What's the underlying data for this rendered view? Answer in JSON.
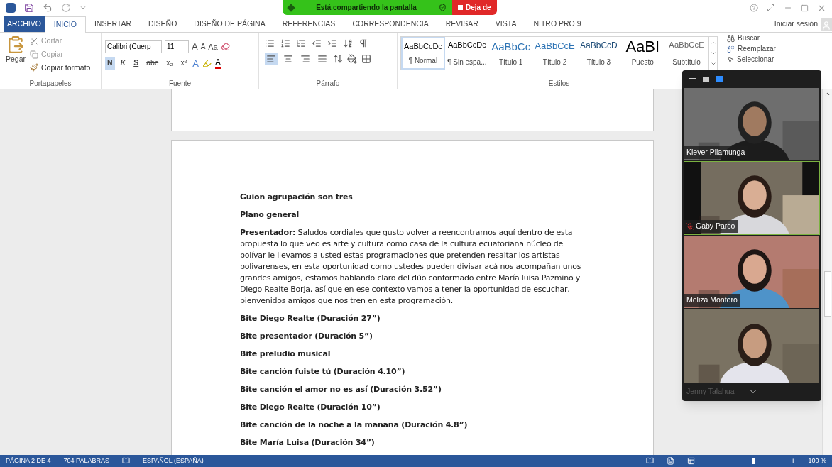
{
  "share_banner": {
    "message": "Está compartiendo la pantalla",
    "stop_label": "Deja de"
  },
  "menu_tabs": [
    {
      "label": "ARCHIVO",
      "kind": "file",
      "selected": false
    },
    {
      "label": "INICIO",
      "kind": "tab",
      "selected": true
    },
    {
      "label": "INSERTAR",
      "kind": "tab",
      "selected": false
    },
    {
      "label": "DISEÑO",
      "kind": "tab",
      "selected": false
    },
    {
      "label": "DISEÑO DE PÁGINA",
      "kind": "tab",
      "selected": false
    },
    {
      "label": "REFERENCIAS",
      "kind": "tab",
      "selected": false
    },
    {
      "label": "CORRESPONDENCIA",
      "kind": "tab",
      "selected": false
    },
    {
      "label": "REVISAR",
      "kind": "tab",
      "selected": false
    },
    {
      "label": "VISTA",
      "kind": "tab",
      "selected": false
    },
    {
      "label": "NITRO PRO 9",
      "kind": "tab",
      "selected": false
    }
  ],
  "sign_in": "Iniciar sesión",
  "clipboard": {
    "paste": "Pegar",
    "cut": "Cortar",
    "copy": "Copiar",
    "format_painter": "Copiar formato",
    "group": "Portapapeles"
  },
  "font": {
    "name": "Calibri (Cuerp",
    "size": "11",
    "grow": "A",
    "shrink": "A",
    "case": "Aa",
    "group": "Fuente",
    "styles": [
      {
        "label": "N",
        "kind": "bold",
        "selected": true
      },
      {
        "label": "K",
        "kind": "italic",
        "selected": false
      },
      {
        "label": "S",
        "kind": "underline",
        "selected": false
      },
      {
        "label": "abc",
        "kind": "strike",
        "selected": false
      },
      {
        "label": "x₂",
        "kind": "plain",
        "selected": false
      },
      {
        "label": "x²",
        "kind": "plain",
        "selected": false
      }
    ],
    "effects": "A",
    "color_letter": "A"
  },
  "paragraph": {
    "group": "Párrafo",
    "alignments": [
      {
        "kind": "left",
        "selected": true
      },
      {
        "kind": "center",
        "selected": false
      },
      {
        "kind": "right",
        "selected": false
      },
      {
        "kind": "justify",
        "selected": false
      }
    ]
  },
  "styles": {
    "group": "Estilos",
    "items": [
      {
        "sample": "AaBbCcDc",
        "name": "¶ Normal",
        "kind": "body",
        "selected": true
      },
      {
        "sample": "AaBbCcDc",
        "name": "¶ Sin espa...",
        "kind": "body",
        "selected": false
      },
      {
        "sample": "AaBbCc",
        "name": "Título 1",
        "kind": "h1",
        "selected": false
      },
      {
        "sample": "AaBbCcE",
        "name": "Título 2",
        "kind": "h2",
        "selected": false
      },
      {
        "sample": "AaBbCcD",
        "name": "Título 3",
        "kind": "h3",
        "selected": false
      },
      {
        "sample": "AaBI",
        "name": "Puesto",
        "kind": "title",
        "selected": false
      },
      {
        "sample": "AaBbCcE",
        "name": "Subtítulo",
        "kind": "subtitle",
        "selected": false
      }
    ]
  },
  "editing": {
    "find": "Buscar",
    "replace": "Reemplazar",
    "select": "Seleccionar"
  },
  "document": [
    {
      "kind": "heading",
      "text": "Guion agrupación son tres"
    },
    {
      "kind": "heading",
      "text": "Plano general"
    },
    {
      "kind": "paragraph",
      "text": "**Presentador:** Saludos cordiales que gusto volver a reencontrarnos aquí dentro de esta propuesta lo que veo es arte y cultura como casa de la cultura ecuatoriana núcleo de bolívar le llevamos a usted estas programaciones que pretenden resaltar los artistas bolivarenses, en esta oportunidad como ustedes pueden divisar acá nos acompañan unos grandes amigos, estamos hablando claro del dúo conformado entre María luisa Pazmiño y Diego Realte Borja, así que en ese contexto vamos a tener la oportunidad de escuchar, bienvenidos amigos que nos tren en esta programación."
    },
    {
      "kind": "heading",
      "text": "Bite Diego Realte (Duración 27”)"
    },
    {
      "kind": "heading",
      "text": "Bite presentador (Duración 5”)"
    },
    {
      "kind": "heading",
      "text": "Bite preludio musical"
    },
    {
      "kind": "heading",
      "text": "Bite canción fuiste tú (Duración 4.10”)"
    },
    {
      "kind": "heading",
      "text": "Bite canción el amor no es así (Duración 3.52”)"
    },
    {
      "kind": "heading",
      "text": "Bite Diego Realte (Duración 10”)"
    },
    {
      "kind": "heading",
      "text": "Bite canción de la noche a la mañana (Duración 4.8”)"
    },
    {
      "kind": "heading",
      "text": "Bite María Luisa (Duración 34”)"
    }
  ],
  "participants": [
    {
      "name": "Klever Pilamunga",
      "muted": false,
      "active": false
    },
    {
      "name": "Gaby Parco",
      "muted": true,
      "active": true
    },
    {
      "name": "Meliza Montero",
      "muted": false,
      "active": false
    },
    {
      "name": "Jenny Talahua",
      "muted": false,
      "active": false
    }
  ],
  "status_bar": {
    "page": "PÁGINA 2 DE 4",
    "words": "704 PALABRAS",
    "language": "ESPAÑOL (ESPAÑA)",
    "zoom": "100 %",
    "zoom_in": "+",
    "zoom_slider": {
      "level": 0.5
    }
  }
}
